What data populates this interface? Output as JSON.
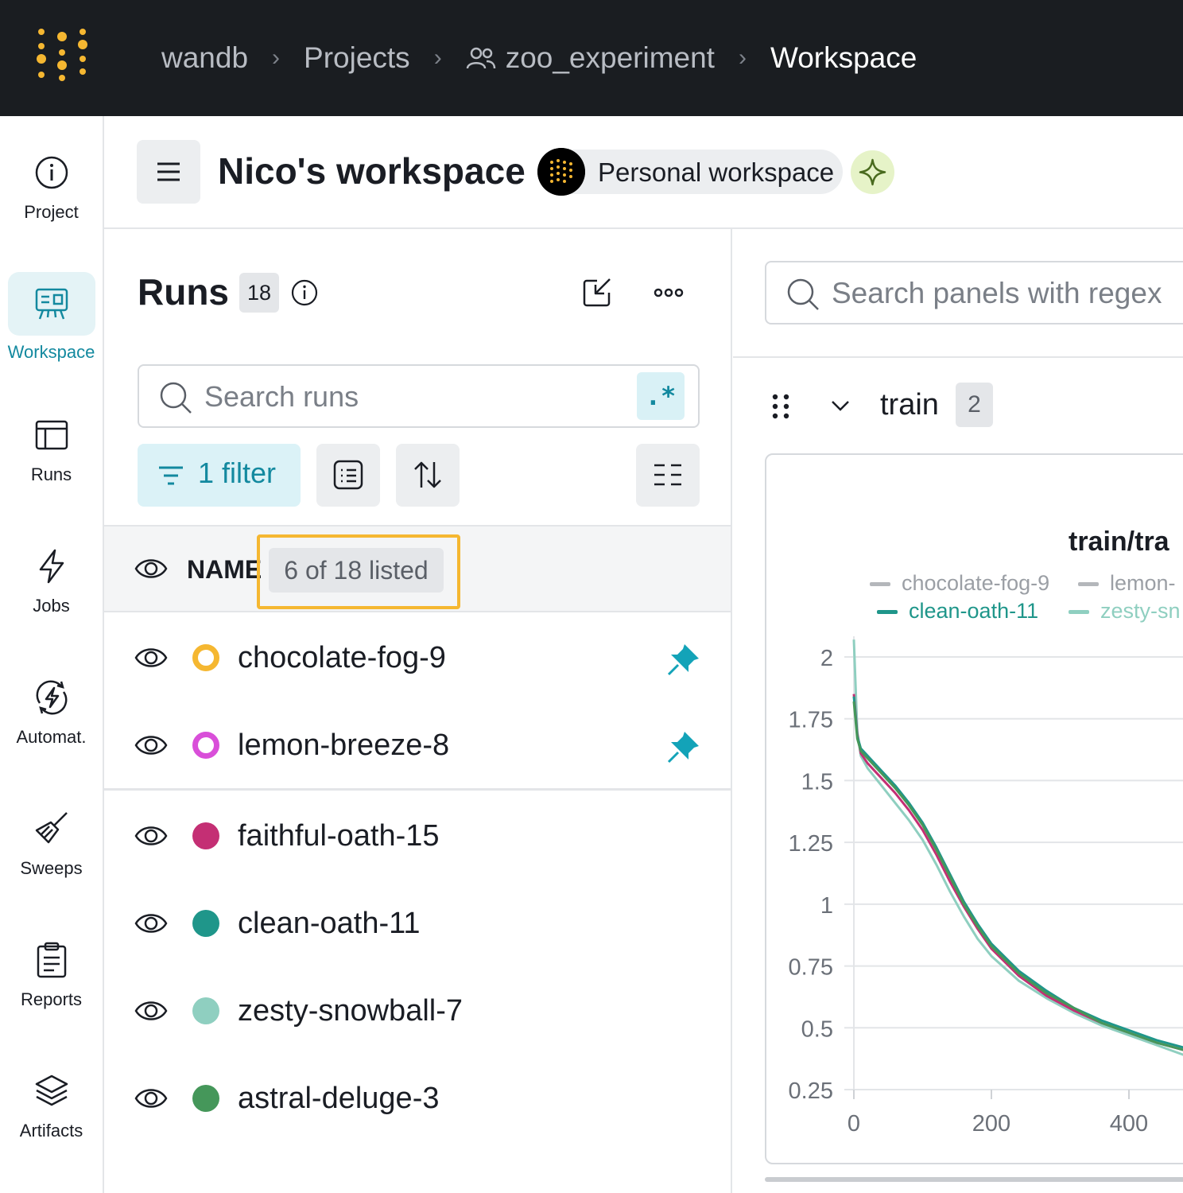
{
  "breadcrumb": {
    "items": [
      "wandb",
      "Projects",
      "zoo_experiment",
      "Workspace"
    ]
  },
  "nav": {
    "items": [
      {
        "label": "Project",
        "icon": "info-circle-icon"
      },
      {
        "label": "Workspace",
        "icon": "workspace-icon",
        "active": true
      },
      {
        "label": "Runs",
        "icon": "table-icon"
      },
      {
        "label": "Jobs",
        "icon": "lightning-icon"
      },
      {
        "label": "Automat.",
        "icon": "automation-icon"
      },
      {
        "label": "Sweeps",
        "icon": "broom-icon"
      },
      {
        "label": "Reports",
        "icon": "clipboard-icon"
      },
      {
        "label": "Artifacts",
        "icon": "layers-icon"
      }
    ]
  },
  "workspace": {
    "title": "Nico's workspace",
    "type_label": "Personal workspace"
  },
  "runs": {
    "title": "Runs",
    "count": "18",
    "search_placeholder": "Search runs",
    "regex_label": ".*",
    "filter_label": "1 filter",
    "column_name": "NAME",
    "listed_label": "6 of 18 listed",
    "rows": [
      {
        "name": "chocolate-fog-9",
        "color": "#f5b731",
        "style": "ring",
        "pinned": true
      },
      {
        "name": "lemon-breeze-8",
        "color": "#d94fd9",
        "style": "ring",
        "pinned": true
      },
      {
        "name": "faithful-oath-15",
        "color": "#c42f74",
        "style": "solid",
        "pinned": false
      },
      {
        "name": "clean-oath-11",
        "color": "#1f968a",
        "style": "solid",
        "pinned": false
      },
      {
        "name": "zesty-snowball-7",
        "color": "#8fcfc0",
        "style": "solid",
        "pinned": false
      },
      {
        "name": "astral-deluge-3",
        "color": "#45975a",
        "style": "solid",
        "pinned": false
      }
    ]
  },
  "panels": {
    "search_placeholder": "Search panels with regex",
    "section_title": "train",
    "section_count": "2"
  },
  "colors": {
    "accent": "#13899f",
    "topbar": "#1a1d21",
    "highlight": "#f5b731"
  },
  "chart_data": {
    "type": "line",
    "title": "train/tra",
    "legend": [
      "chocolate-fog-9",
      "lemon-",
      "clean-oath-11",
      "zesty-sn"
    ],
    "legend_colors": [
      "#b4b7bb",
      "#b4b7bb",
      "#1f968a",
      "#8fcfc0"
    ],
    "legend_placement": "top",
    "ylim": [
      0.25,
      2.1
    ],
    "xlim": [
      0,
      480
    ],
    "y_ticks": [
      "2",
      "1.75",
      "1.5",
      "1.25",
      "1",
      "0.75",
      "0.5",
      "0.25"
    ],
    "x_ticks": [
      "0",
      "200",
      "400"
    ],
    "grid": true,
    "series": [
      {
        "name": "zesty-snowball-7",
        "color": "#8fcfc0",
        "x": [
          0,
          5,
          10,
          20,
          40,
          60,
          80,
          100,
          120,
          140,
          160,
          180,
          200,
          240,
          280,
          320,
          360,
          400,
          440,
          480
        ],
        "y": [
          2.07,
          1.7,
          1.6,
          1.55,
          1.48,
          1.41,
          1.34,
          1.26,
          1.16,
          1.05,
          0.95,
          0.86,
          0.79,
          0.69,
          0.62,
          0.56,
          0.51,
          0.47,
          0.43,
          0.39
        ]
      },
      {
        "name": "faithful-oath-15",
        "color": "#c42f74",
        "x": [
          0,
          5,
          10,
          20,
          40,
          60,
          80,
          100,
          120,
          140,
          160,
          180,
          200,
          240,
          280,
          320,
          360,
          400,
          440,
          480
        ],
        "y": [
          1.85,
          1.69,
          1.61,
          1.57,
          1.51,
          1.45,
          1.38,
          1.3,
          1.2,
          1.09,
          0.99,
          0.9,
          0.82,
          0.71,
          0.63,
          0.57,
          0.52,
          0.48,
          0.44,
          0.41
        ]
      },
      {
        "name": "clean-oath-11",
        "color": "#1f968a",
        "x": [
          0,
          5,
          10,
          20,
          40,
          60,
          80,
          100,
          120,
          140,
          160,
          180,
          200,
          240,
          280,
          320,
          360,
          400,
          440,
          480
        ],
        "y": [
          1.84,
          1.68,
          1.63,
          1.6,
          1.54,
          1.48,
          1.41,
          1.33,
          1.23,
          1.12,
          1.01,
          0.92,
          0.84,
          0.73,
          0.65,
          0.58,
          0.53,
          0.49,
          0.45,
          0.42
        ]
      },
      {
        "name": "astral-deluge-3",
        "color": "#45975a",
        "x": [
          0,
          5,
          10,
          20,
          40,
          60,
          80,
          100,
          120,
          140,
          160,
          180,
          200,
          240,
          280,
          320,
          360,
          400,
          440,
          480
        ],
        "y": [
          1.82,
          1.67,
          1.62,
          1.59,
          1.53,
          1.47,
          1.4,
          1.32,
          1.22,
          1.11,
          1.0,
          0.91,
          0.83,
          0.72,
          0.64,
          0.58,
          0.52,
          0.48,
          0.44,
          0.41
        ]
      }
    ]
  }
}
